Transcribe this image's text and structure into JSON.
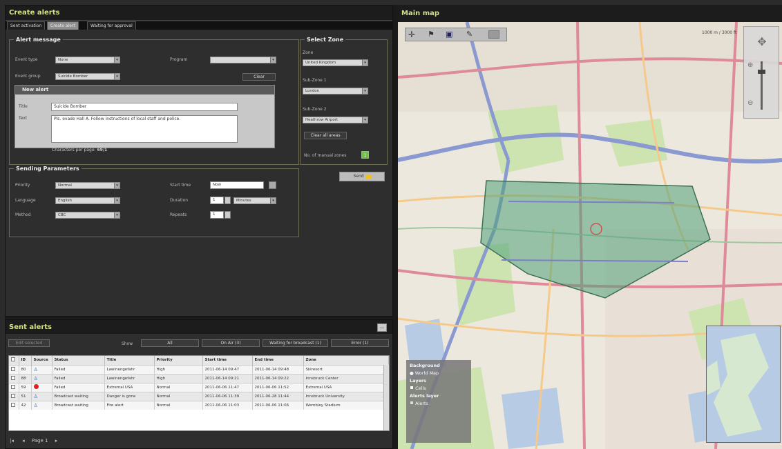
{
  "create_alerts": {
    "title": "Create alerts",
    "tabs": [
      "Sent activation",
      "Create alert",
      "Waiting for approval"
    ],
    "alert_message": {
      "legend": "Alert message",
      "event_type_label": "Event type",
      "event_type_value": "None",
      "program_label": "Program",
      "event_group_label": "Event group",
      "event_group_value": "Suicide Bomber",
      "clear_label": "Clear",
      "new_alert_legend": "New alert",
      "title_label": "Title",
      "title_value": "Suicide Bomber",
      "text_label": "Text",
      "text_value": "Pls. evade Hall A. Follow instructions of local staff and police.",
      "chars_label": "Characters per page:",
      "chars_value": "69/1"
    },
    "select_zone": {
      "legend": "Select Zone",
      "zone_label": "Zone",
      "zone_value": "United Kingdom",
      "subzone1_label": "Sub-Zone 1",
      "subzone1_value": "London",
      "subzone2_label": "Sub-Zone 2",
      "subzone2_value": "Heathrow Airport",
      "clear_all_label": "Clear all areas",
      "manual_zones_label": "No. of manual zones",
      "manual_zones_value": "1"
    },
    "send_label": "Send",
    "sending_parameters": {
      "legend": "Sending Parameters",
      "priority_label": "Priority",
      "priority_value": "Normal",
      "start_time_label": "Start time",
      "start_time_value": "Now",
      "language_label": "Language",
      "language_value": "English",
      "duration_label": "Duration",
      "duration_value": "1",
      "duration_unit": "Minutes",
      "method_label": "Method",
      "method_value": "CBC",
      "repeats_label": "Repeats",
      "repeats_value": "1"
    }
  },
  "sent_alerts": {
    "title": "Sent alerts",
    "edit_selected_label": "Edit selected",
    "show_label": "Show",
    "filters": [
      "All",
      "On Air (3)",
      "Waiting for broadcast (1)",
      "Error (1)"
    ],
    "columns": [
      "ID",
      "Source",
      "Status",
      "Title",
      "Priority",
      "Start time",
      "End time",
      "Zone"
    ],
    "rows": [
      {
        "id": "80",
        "source": "person",
        "status": "Failed",
        "title": "Lawinengefahr",
        "priority": "High",
        "start": "2011-06-14 09:47",
        "end": "2011-06-14 09:48",
        "zone": "Skiresort"
      },
      {
        "id": "88",
        "source": "person",
        "status": "Failed",
        "title": "Lawinengefahr",
        "priority": "High",
        "start": "2011-06-14 09:21",
        "end": "2011-06-14 09:22",
        "zone": "Innsbruck Center"
      },
      {
        "id": "59",
        "source": "red",
        "status": "Failed",
        "title": "Extremal USA",
        "priority": "Normal",
        "start": "2011-06-06 11:47",
        "end": "2011-06-06 11:52",
        "zone": "Extremal USA"
      },
      {
        "id": "51",
        "source": "person",
        "status": "Broadcast waiting",
        "title": "Danger is gone",
        "priority": "Normal",
        "start": "2011-06-06 11:39",
        "end": "2011-06-28 11:44",
        "zone": "Innsbruck University"
      },
      {
        "id": "42",
        "source": "person",
        "status": "Broadcast waiting",
        "title": "Fire alert",
        "priority": "Normal",
        "start": "2011-06-06 11:03",
        "end": "2011-06-06 11:06",
        "zone": "Wembley Stadium"
      }
    ],
    "page_label": "Page 1"
  },
  "main_map": {
    "title": "Main map",
    "scale_text": "1000 m / 3000 ft",
    "layers_panel": {
      "background_label": "Background",
      "background_option": "World Map",
      "layers_label": "Layers",
      "layers_option": "Cells",
      "alerts_layer_label": "Alerts layer",
      "alerts_option": "Alerts"
    }
  },
  "colors": {
    "title_accent": "#d4e08a",
    "zone_fill": "#4fa07a",
    "failed_red": "#e02020"
  }
}
